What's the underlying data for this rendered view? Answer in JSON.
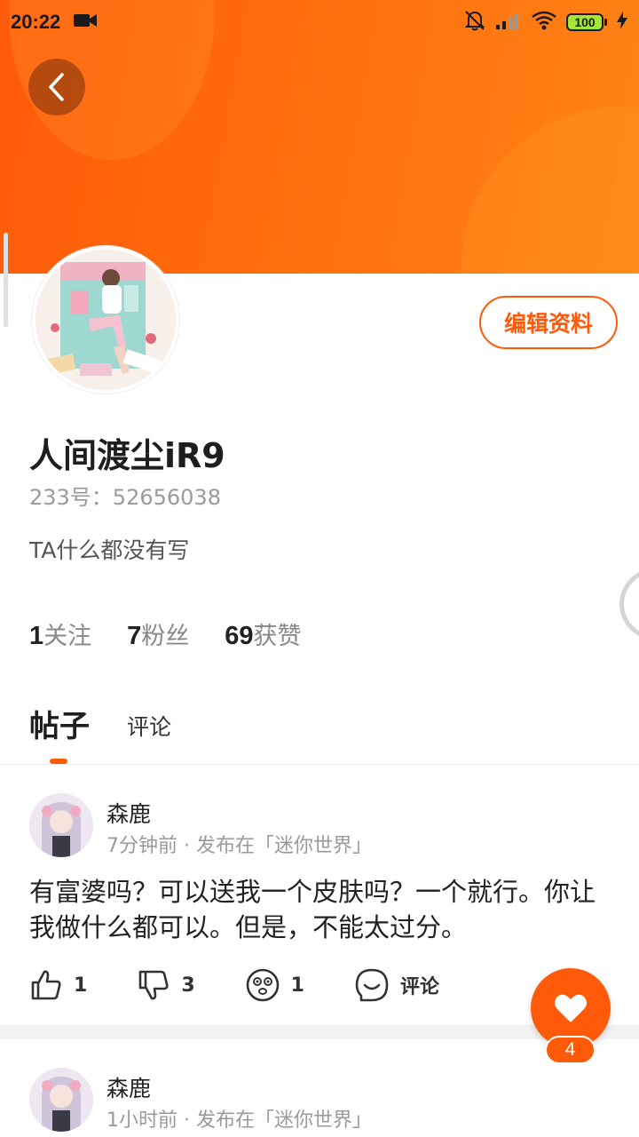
{
  "status_bar": {
    "time": "20:22",
    "battery": "100"
  },
  "profile": {
    "edit_label": "编辑资料",
    "username": "人间渡尘iR9",
    "user_id": "233号：52656038",
    "bio": "TA什么都没有写",
    "stats": [
      {
        "value": "1",
        "label": "关注"
      },
      {
        "value": "7",
        "label": "粉丝"
      },
      {
        "value": "69",
        "label": "获赞"
      }
    ]
  },
  "tabs": [
    {
      "label": "帖子",
      "active": true
    },
    {
      "label": "评论",
      "active": false
    }
  ],
  "posts": [
    {
      "author": "森鹿",
      "meta": "7分钟前 · 发布在「迷你世界」",
      "body": "有富婆吗？可以送我一个皮肤吗？一个就行。你让我做什么都可以。但是，不能太过分。",
      "actions": {
        "like": "1",
        "dislike": "3",
        "wow": "1",
        "comment": "评论"
      }
    },
    {
      "author": "森鹿",
      "meta": "1小时前 · 发布在「迷你世界」"
    }
  ],
  "fab": {
    "count": "4"
  },
  "colors": {
    "accent": "#ff5a0a",
    "header_gradient_end": "#ff8416"
  }
}
